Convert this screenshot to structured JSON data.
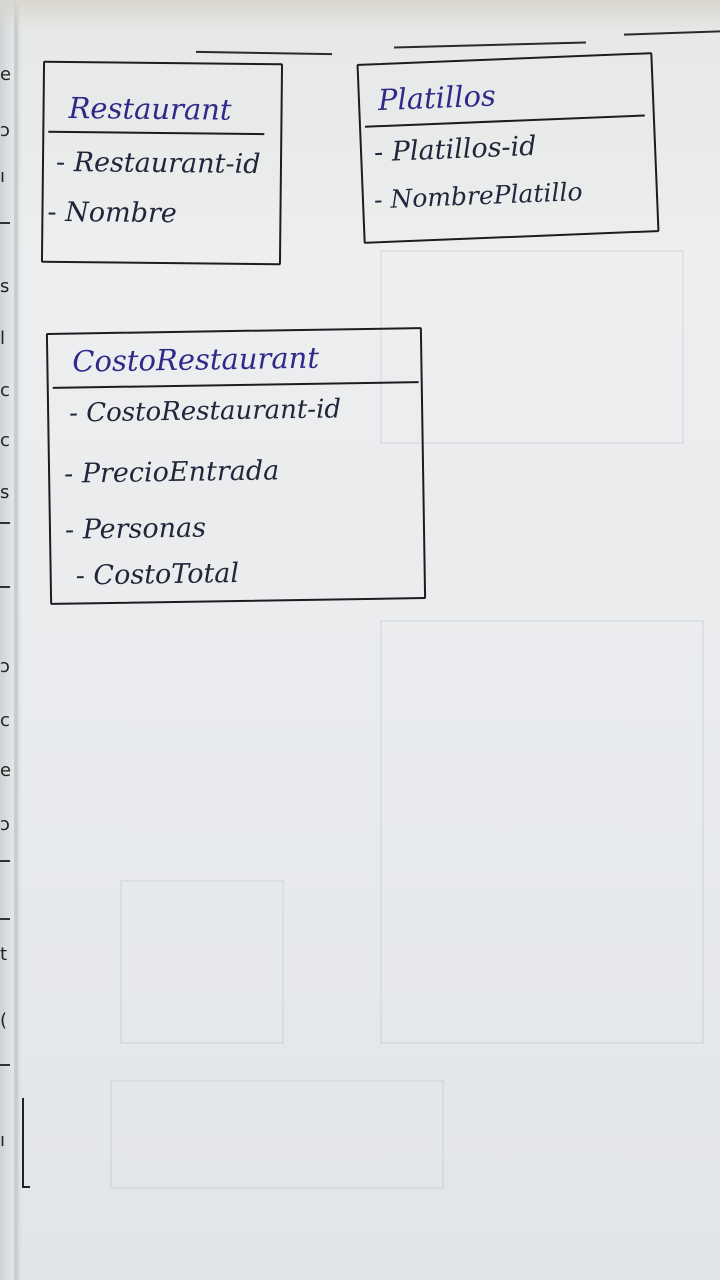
{
  "diagram": {
    "entities": [
      {
        "id": "restaurant",
        "title": "Restaurant",
        "attributes": [
          "Restaurant-id",
          "Nombre"
        ]
      },
      {
        "id": "platillos",
        "title": "Platillos",
        "attributes": [
          "Platillos-id",
          "NombrePlatillo"
        ]
      },
      {
        "id": "costo-restaurant",
        "title": "CostoRestaurant",
        "attributes": [
          "CostoRestaurant-id",
          "PrecioEntrada",
          "Personas",
          "CostoTotal"
        ]
      }
    ],
    "attribute_prefix": "- "
  },
  "colors": {
    "ink_title": "#2e2a8a",
    "ink_attribute": "#24243a",
    "box_line": "#1d1d20",
    "paper": "#eceeef"
  }
}
